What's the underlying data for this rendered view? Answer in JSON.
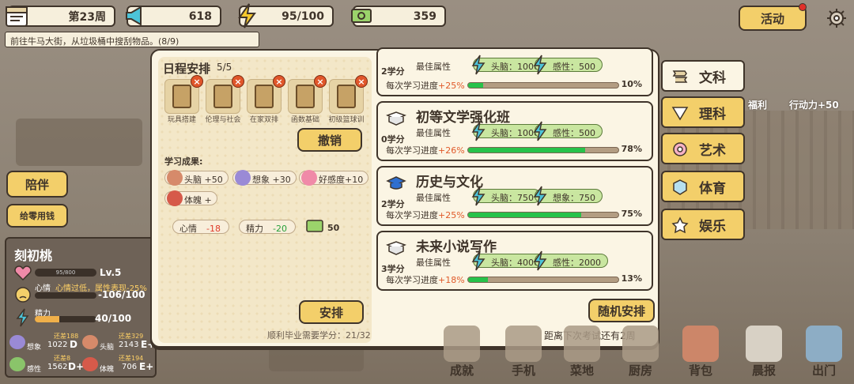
{
  "topbar": {
    "day": "第23周",
    "fame": "618",
    "energy": "95/100",
    "money": "359",
    "quest": "前往牛马大街，从垃圾桶中搜刮物品。(8/9)",
    "activity": "活动"
  },
  "left_buttons": {
    "accompany": "陪伴",
    "pocket_money": "给零用钱"
  },
  "character": {
    "name": "刻初桃",
    "hp": "95/800",
    "level": "Lv.5",
    "mood_label": "心情",
    "mood_warning": "心情过低，属性表现-25%",
    "mood_value": "-106/100",
    "stamina_label": "精力",
    "stamina_value": "40/100",
    "stats": [
      {
        "label": "想象",
        "value": "1022",
        "grade": "D",
        "need": "还差188"
      },
      {
        "label": "头脑",
        "value": "2143",
        "grade": "E+",
        "need": "还差329"
      },
      {
        "label": "感性",
        "value": "1562",
        "grade": "D+",
        "need": "还差8"
      },
      {
        "label": "体魄",
        "value": "706",
        "grade": "E+",
        "need": "还差194"
      }
    ]
  },
  "schedule": {
    "title": "日程安排",
    "count": "5/5",
    "items": [
      "玩具搭建",
      "伦理与社会",
      "在家双排",
      "函数基础",
      "初级篮球训"
    ],
    "cancel": "撤销",
    "results_title": "学习成果:",
    "gains": [
      {
        "label": "头脑",
        "value": "+50"
      },
      {
        "label": "想象",
        "value": "+30"
      },
      {
        "label": "好感度",
        "value": "+10"
      },
      {
        "label": "体魄",
        "value": "+"
      }
    ],
    "mood": {
      "label": "心情",
      "value": "-18"
    },
    "stamina": {
      "label": "精力",
      "value": "-20"
    },
    "cost": "50",
    "arrange": "安排",
    "credits_needed": "顺利毕业需要学分：21/32"
  },
  "courses": [
    {
      "title": "",
      "credit": "2学分",
      "attr_label": "最佳属性",
      "attrs": [
        "头脑：1000",
        "感性：500"
      ],
      "progress_label": "每次学习进度",
      "progress_up": "+25%",
      "progress": 10,
      "pct": "10%"
    },
    {
      "title": "初等文学强化班",
      "credit": "0学分",
      "attr_label": "最佳属性",
      "attrs": [
        "头脑：1000",
        "感性：500"
      ],
      "progress_label": "每次学习进度",
      "progress_up": "+26%",
      "progress": 78,
      "pct": "78%"
    },
    {
      "title": "历史与文化",
      "credit": "2学分",
      "attr_label": "最佳属性",
      "attrs": [
        "头脑：750",
        "想象：750"
      ],
      "progress_label": "每次学习进度",
      "progress_up": "+25%",
      "progress": 75,
      "pct": "75%"
    },
    {
      "title": "未来小说写作",
      "credit": "3学分",
      "attr_label": "最佳属性",
      "attrs": [
        "头脑：4000",
        "感性：2000"
      ],
      "progress_label": "每次学习进度",
      "progress_up": "+18%",
      "progress": 13,
      "pct": "13%"
    }
  ],
  "random_arrange": "随机安排",
  "exam_notice": "距离下次考试还有2周",
  "categories": [
    "文科",
    "理科",
    "艺术",
    "体育",
    "娱乐"
  ],
  "side_labels": [
    "福利",
    "行动力+50"
  ],
  "bottom_nav": [
    "成就",
    "手机",
    "菜地",
    "厨房",
    "背包",
    "晨报",
    "出门"
  ],
  "colors": {
    "accent_yellow": "#f3cf6a",
    "progress_green": "#27c24a",
    "warning_red": "#e05a2a",
    "panel_cream": "#fbf5e4"
  }
}
